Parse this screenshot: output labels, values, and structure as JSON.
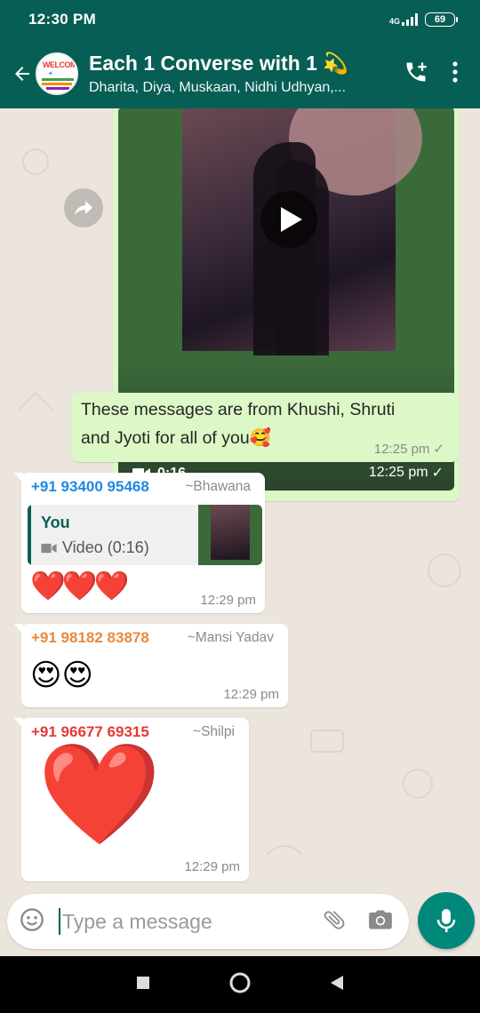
{
  "status_bar": {
    "time": "12:30 PM",
    "network": "4G",
    "battery": "69"
  },
  "header": {
    "title": "Each 1 Converse with 1",
    "title_emoji": "💫",
    "subtitle": "Dharita, Diya, Muskaan, Nidhi Udhyan,...",
    "avatar_text": "WELCOME"
  },
  "messages": {
    "video": {
      "duration": "0:16",
      "time": "12:25 pm",
      "status": "✓"
    },
    "text_out": {
      "text_line1": "These messages are from Khushi, Shruti",
      "text_line2": "and Jyoti for all of you",
      "emoji": "🥰",
      "time": "12:25 pm",
      "status": "✓"
    },
    "msg1": {
      "sender": "+91 93400 95468",
      "pushname": "~Bhawana",
      "reply_name": "You",
      "reply_sub": "Video (0:16)",
      "text": "❤️❤️❤️",
      "time": "12:29 pm"
    },
    "msg2": {
      "sender": "+91 98182 83878",
      "pushname": "~Mansi Yadav",
      "text": "😍😍",
      "time": "12:29 pm"
    },
    "msg3": {
      "sender": "+91 96677 69315",
      "pushname": "~Shilpi",
      "text": "❤️",
      "time": "12:29 pm"
    }
  },
  "input": {
    "placeholder": "Type a message"
  },
  "colors": {
    "header": "#075e54",
    "outgoing": "#dcf8c6",
    "sender1": "#1e88e5",
    "sender2": "#e88a3d",
    "sender3": "#e53935",
    "mic": "#00897b"
  },
  "icons": [
    "back-arrow-icon",
    "add-call-icon",
    "more-vert-icon",
    "forward-icon",
    "play-icon",
    "video-camera-icon",
    "smiley-icon",
    "attach-icon",
    "camera-icon",
    "mic-icon",
    "nav-square-icon",
    "nav-circle-icon",
    "nav-triangle-icon"
  ]
}
